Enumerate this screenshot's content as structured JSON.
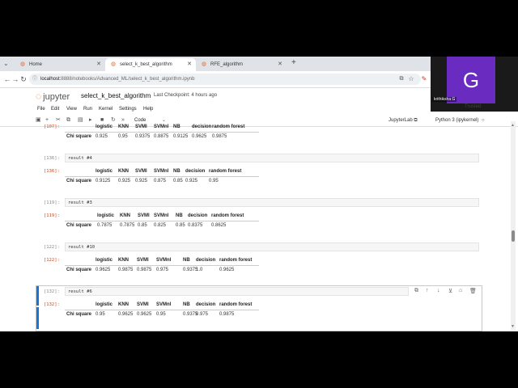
{
  "tabs": [
    {
      "label": "Home",
      "active": false
    },
    {
      "label": "select_k_best_algorithm",
      "active": true
    },
    {
      "label": "RFE_algorithm",
      "active": false
    }
  ],
  "address": {
    "host": "localhost:",
    "rest": "8888/notebooks/Advanced_ML/select_k_best_algorithm.ipynb"
  },
  "webcam": {
    "initial": "G",
    "name": "krithiksha G",
    "trusted": "Trusted"
  },
  "jupyter": {
    "logo": "jupyter",
    "notebook_title": "select_k_best_algorithm",
    "checkpoint": "Last Checkpoint: 4 hours ago",
    "menu": [
      "File",
      "Edit",
      "View",
      "Run",
      "Kernel",
      "Settings",
      "Help"
    ],
    "cell_type": "Code",
    "jupyterlab_label": "JupyterLab",
    "kernel": "Python 3 (ipykernel)"
  },
  "columns": [
    "logistic",
    "KNN",
    "SVMl",
    "SVMnl",
    "NB",
    "decision",
    "random forest"
  ],
  "row_label": "Chi square",
  "cells": [
    {
      "in": "",
      "out": "[107]:",
      "values": [
        "0.925",
        "0.95",
        "0.9375",
        "0.8875",
        "0.9125",
        "0.9625",
        "0.9875"
      ]
    },
    {
      "in": "[136]:",
      "code": "result #4",
      "out": "[136]:",
      "values": [
        "0.9125",
        "0.925",
        "0.925",
        "0.875",
        "0.85",
        "0.925",
        "0.95"
      ]
    },
    {
      "in": "[119]:",
      "code": "result #3",
      "out": "[119]:",
      "values": [
        "0.7875",
        "0.7875",
        "0.85",
        "0.825",
        "0.85",
        "0.8375",
        "0.8625"
      ]
    },
    {
      "in": "[122]:",
      "code": "result #10",
      "out": "[122]:",
      "values": [
        "0.9625",
        "0.9875",
        "0.9875",
        "0.975",
        "0.9375",
        "1.0",
        "0.9625"
      ]
    },
    {
      "in": "[132]:",
      "code": "result #6",
      "out": "[132]:",
      "values": [
        "0.95",
        "0.9625",
        "0.9625",
        "0.95",
        "0.9375",
        "0.975",
        "0.9875"
      ]
    }
  ],
  "colors": {
    "accent": "#1976d2",
    "jupyter_orange": "#f37726",
    "avatar": "#6a2cc0"
  }
}
